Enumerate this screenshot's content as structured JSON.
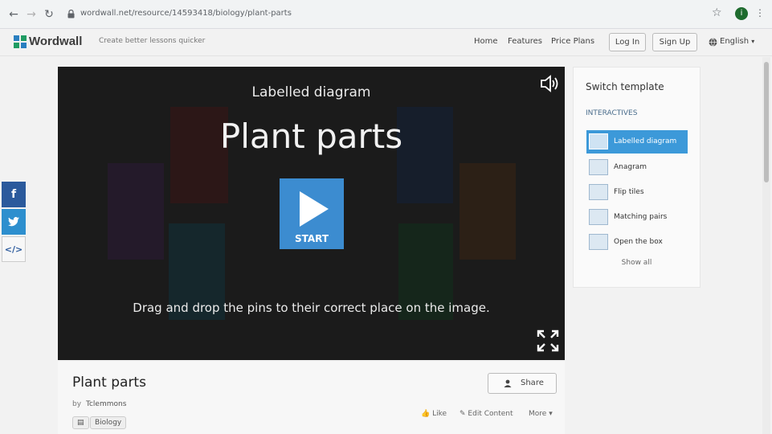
{
  "browser": {
    "url": "wordwall.net/resource/14593418/biology/plant-parts",
    "profile_initial": "i"
  },
  "header": {
    "logo": "Wordwall",
    "tagline": "Create better lessons quicker",
    "nav": [
      "Home",
      "Features",
      "Price Plans"
    ],
    "login": "Log In",
    "signup": "Sign Up",
    "language": "English"
  },
  "player": {
    "template_type": "Labelled diagram",
    "title": "Plant parts",
    "start_label": "START",
    "instruction": "Drag and drop the pins to their correct place on the image."
  },
  "template_panel": {
    "heading": "Switch template",
    "subheading": "INTERACTIVES",
    "items": [
      {
        "label": "Labelled diagram",
        "active": true,
        "icon": "labelled-diagram-icon"
      },
      {
        "label": "Anagram",
        "active": false,
        "icon": "anagram-icon"
      },
      {
        "label": "Flip tiles",
        "active": false,
        "icon": "flip-tiles-icon"
      },
      {
        "label": "Matching pairs",
        "active": false,
        "icon": "matching-pairs-icon"
      },
      {
        "label": "Open the box",
        "active": false,
        "icon": "open-the-box-icon"
      }
    ],
    "show_all": "Show all"
  },
  "activity": {
    "title": "Plant parts",
    "share_label": "Share",
    "by_label": "by",
    "author": "Tclemmons",
    "like_label": "Like",
    "edit_label": "Edit Content",
    "more_label": "More",
    "tags": [
      "Biology"
    ]
  },
  "colors": {
    "accent": "#3c8cd0",
    "facebook": "#2b5a9c",
    "twitter": "#2d8fce"
  }
}
